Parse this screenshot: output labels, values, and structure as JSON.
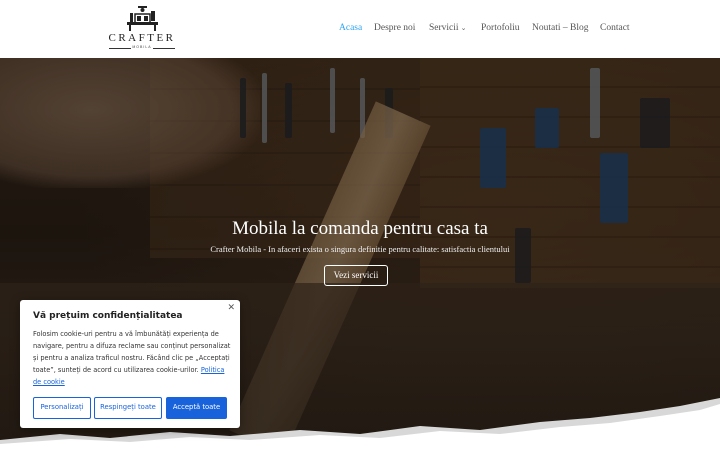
{
  "header": {
    "logo": {
      "name": "CRAFTER",
      "tagline": "MOBILA"
    },
    "nav": [
      {
        "label": "Acasa",
        "active": true
      },
      {
        "label": "Despre noi",
        "active": false
      },
      {
        "label": "Servicii",
        "active": false,
        "has_dropdown": true
      },
      {
        "label": "Portofoliu",
        "active": false
      },
      {
        "label": "Noutati – Blog",
        "active": false
      },
      {
        "label": "Contact",
        "active": false
      }
    ],
    "nav_dropdown_icon": "chevron-down-icon",
    "accent_color": "#2ea3f2"
  },
  "hero": {
    "title": "Mobila la comanda pentru casa ta",
    "subtitle": "Crafter Mobila - In afaceri exista o singura definitie pentru calitate: satisfactia clientului",
    "button_label": "Vezi servicii"
  },
  "cookie_banner": {
    "title": "Vă prețuim confidențialitatea",
    "body": "Folosim cookie-uri pentru a vă îmbunătăți experiența de navigare, pentru a difuza reclame sau conținut personalizat și pentru a analiza traficul nostru. Făcând clic pe „Acceptați toate”, sunteți de acord cu utilizarea cookie-urilor.",
    "policy_link": "Politica de cookie",
    "close_icon": "close-icon",
    "buttons": {
      "customize": "Personalizați",
      "reject": "Respingeți toate",
      "accept": "Acceptă toate"
    },
    "button_color": "#1863dc"
  }
}
